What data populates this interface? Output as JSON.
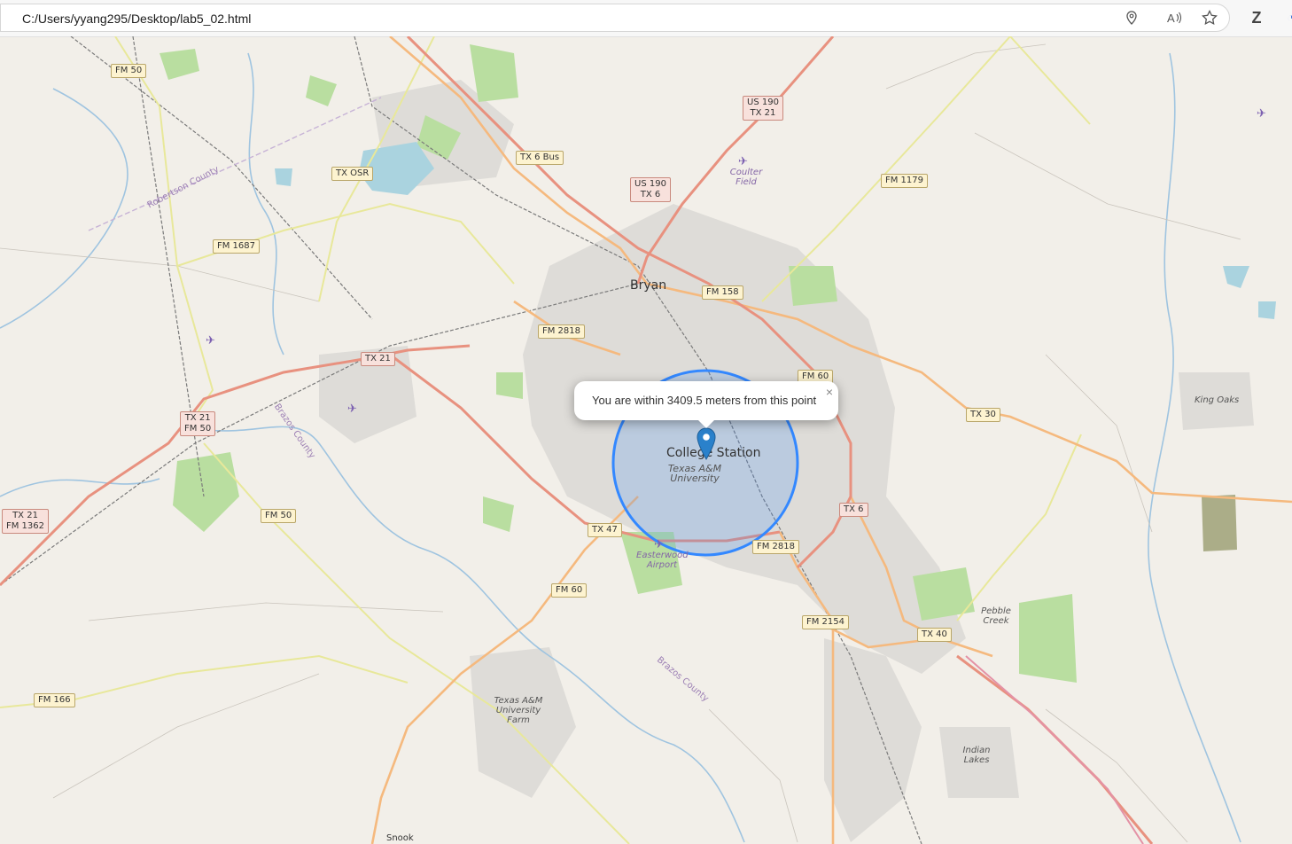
{
  "browser": {
    "url": "C:/Users/yyang295/Desktop/lab5_02.html",
    "icons": [
      "location-icon",
      "read-aloud-icon",
      "favorite-star-icon",
      "extension-z-icon"
    ]
  },
  "popup": {
    "text": "You are within 3409.5 meters from this point",
    "close": "×"
  },
  "map": {
    "cities": {
      "bryan": "Bryan",
      "college_station": "College Station"
    },
    "places": {
      "tamu": "Texas A&M University",
      "coulter": "Coulter Field",
      "easterwood": "Easterwood Airport",
      "king_oaks": "King Oaks",
      "pebble_creek": "Pebble Creek",
      "tamu_farm": "Texas A&M University Farm",
      "indian_lakes": "Indian Lakes",
      "snook": "Snook"
    },
    "counties": {
      "robertson": "Robertson County",
      "brazos1": "Brazos County",
      "brazos2": "Brazos County"
    },
    "shields": {
      "fm50_top": "FM 50",
      "us190_tx21": "US 190\nTX 21",
      "tx6bus": "TX 6 Bus",
      "txosr": "TX OSR",
      "us190_tx6": "US 190\nTX 6",
      "fm1179": "FM 1179",
      "fm1687": "FM 1687",
      "fm158": "FM 158",
      "fm2818_top": "FM 2818",
      "tx21": "TX 21",
      "fm60_top": "FM 60",
      "tx21_fm50": "TX 21\nFM 50",
      "tx30": "TX 30",
      "tx21_fm1362": "TX 21\nFM 1362",
      "fm50_mid": "FM 50",
      "tx6": "TX 6",
      "tx47": "TX 47",
      "fm2818_bot": "FM 2818",
      "fm60_bot": "FM 60",
      "fm2154": "FM 2154",
      "tx40": "TX 40",
      "fm166": "FM 166"
    },
    "accuracy_radius_m": 3409.5,
    "colors": {
      "circle": "#3388ff",
      "marker": "#2a81cb",
      "motorway": "#e8917f",
      "primary": "#f5c08a",
      "secondary": "#f6fabb"
    }
  }
}
